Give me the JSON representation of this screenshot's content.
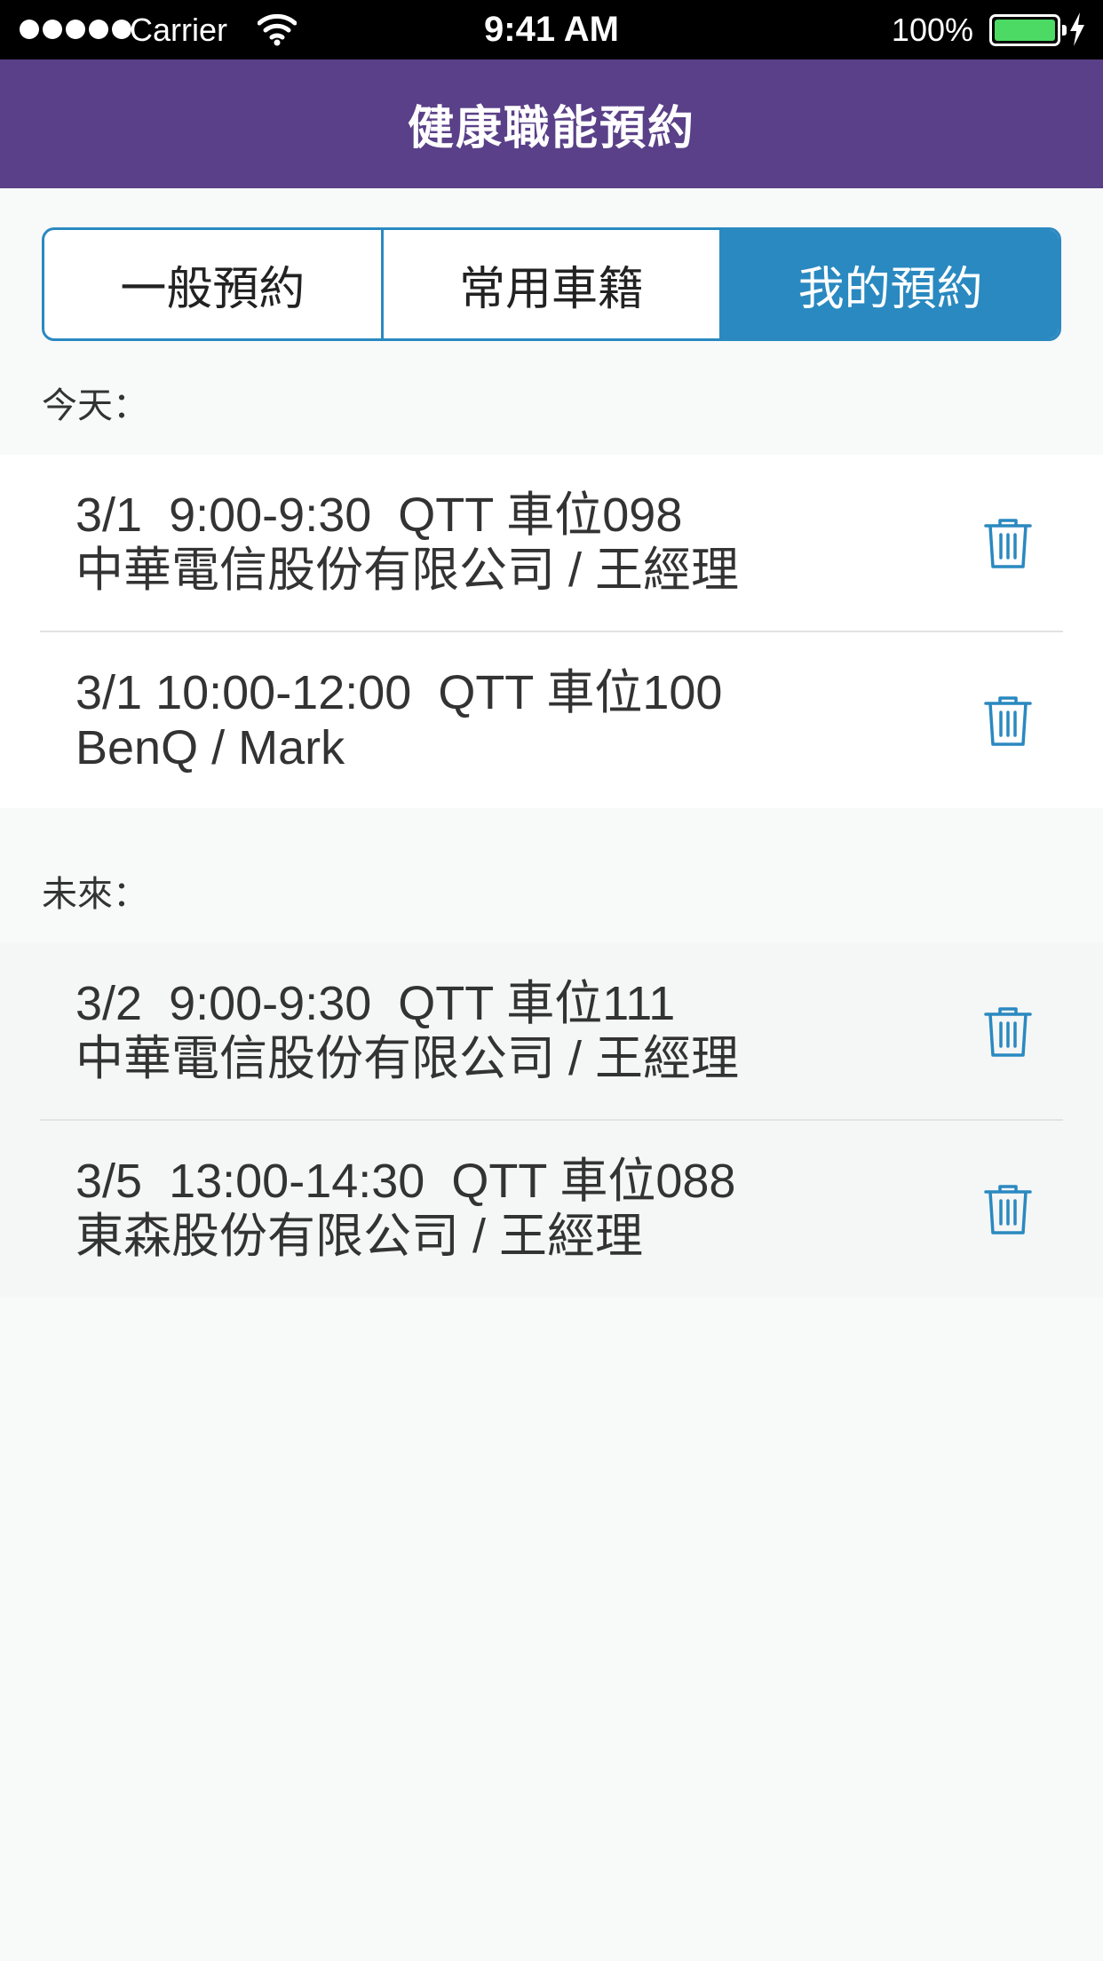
{
  "status_bar": {
    "carrier": "Carrier",
    "time": "9:41 AM",
    "battery": "100%",
    "battery_color": "#4cd964"
  },
  "nav": {
    "title": "健康職能預約",
    "background": "#5a4088"
  },
  "tabs": [
    {
      "label": "一般預約",
      "active": false
    },
    {
      "label": "常用車籍",
      "active": false
    },
    {
      "label": "我的預約",
      "active": true
    }
  ],
  "accent_color": "#2a89c0",
  "sections": {
    "today": {
      "label": "今天：",
      "items": [
        {
          "line1": "3/1  9:00-9:30  QTT 車位098",
          "line2": "中華電信股份有限公司 / 王經理",
          "icon": "trash-icon"
        },
        {
          "line1": "3/1 10:00-12:00  QTT 車位100",
          "line2": "BenQ / Mark",
          "icon": "trash-icon"
        }
      ]
    },
    "future": {
      "label": "未來：",
      "items": [
        {
          "line1": "3/2  9:00-9:30  QTT 車位111",
          "line2": "中華電信股份有限公司 / 王經理",
          "icon": "trash-icon"
        },
        {
          "line1": "3/5  13:00-14:30  QTT 車位088",
          "line2": "東森股份有限公司 / 王經理",
          "icon": "trash-icon"
        }
      ]
    }
  }
}
